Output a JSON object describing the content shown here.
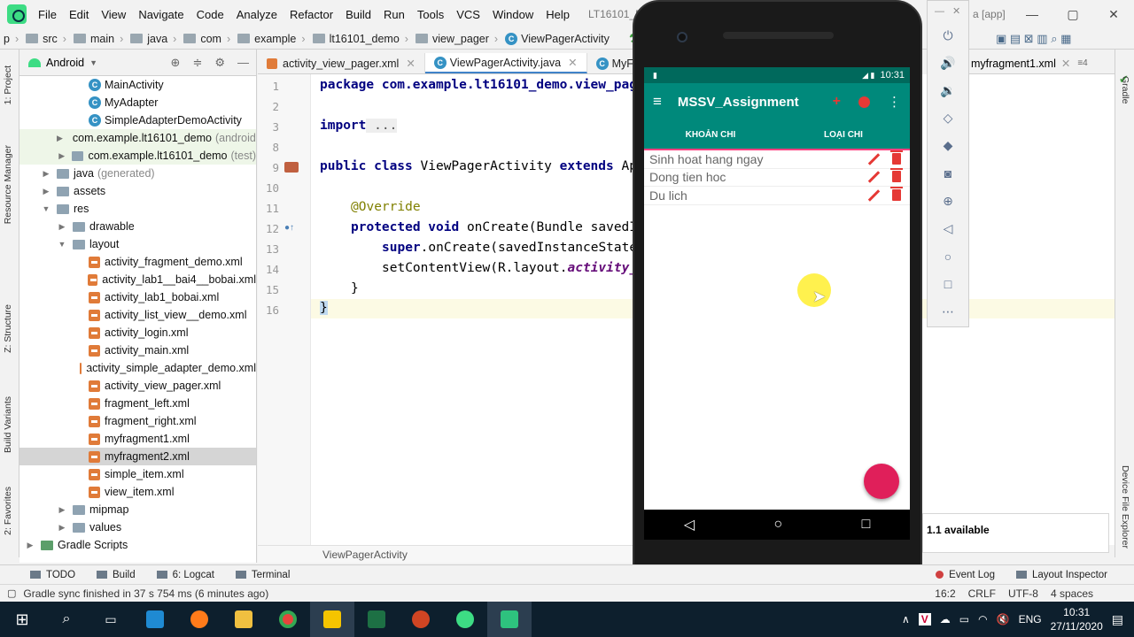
{
  "menubar": {
    "items": [
      "File",
      "Edit",
      "View",
      "Navigate",
      "Code",
      "Analyze",
      "Refactor",
      "Build",
      "Run",
      "Tools",
      "VCS",
      "Window",
      "Help"
    ],
    "window_title": "LT16101_Demo [...\\Dem",
    "window_title_right": "a [app]"
  },
  "breadcrumb": {
    "items": [
      "p",
      "src",
      "main",
      "java",
      "com",
      "example",
      "lt16101_demo",
      "view_pager",
      "ViewPagerActivity"
    ],
    "run_config": "app"
  },
  "left_strip": [
    "1: Project",
    "Resource Manager",
    "Z: Structure",
    "Build Variants",
    "2: Favorites"
  ],
  "right_strip": [
    "Gradle",
    "Device File Explorer"
  ],
  "project": {
    "view_label": "Android",
    "rows": [
      {
        "label": "MainActivity",
        "hint": "",
        "type": "class",
        "indent": 3,
        "arrow": ""
      },
      {
        "label": "MyAdapter",
        "hint": "",
        "type": "class",
        "indent": 3,
        "arrow": ""
      },
      {
        "label": "SimpleAdapterDemoActivity",
        "hint": "",
        "type": "class",
        "indent": 3,
        "arrow": ""
      },
      {
        "label": "com.example.lt16101_demo",
        "hint": "(androidTest)",
        "type": "folder",
        "indent": 2,
        "arrow": "▶"
      },
      {
        "label": "com.example.lt16101_demo",
        "hint": "(test)",
        "type": "folder",
        "indent": 2,
        "arrow": "▶"
      },
      {
        "label": "java",
        "hint": "(generated)",
        "type": "folder",
        "indent": 1,
        "arrow": "▶"
      },
      {
        "label": "assets",
        "hint": "",
        "type": "folder",
        "indent": 1,
        "arrow": "▶"
      },
      {
        "label": "res",
        "hint": "",
        "type": "folder",
        "indent": 1,
        "arrow": "▼"
      },
      {
        "label": "drawable",
        "hint": "",
        "type": "folder",
        "indent": 2,
        "arrow": "▶"
      },
      {
        "label": "layout",
        "hint": "",
        "type": "folder",
        "indent": 2,
        "arrow": "▼"
      },
      {
        "label": "activity_fragment_demo.xml",
        "hint": "",
        "type": "xml",
        "indent": 3,
        "arrow": ""
      },
      {
        "label": "activity_lab1__bai4__bobai.xml",
        "hint": "",
        "type": "xml",
        "indent": 3,
        "arrow": ""
      },
      {
        "label": "activity_lab1_bobai.xml",
        "hint": "",
        "type": "xml",
        "indent": 3,
        "arrow": ""
      },
      {
        "label": "activity_list_view__demo.xml",
        "hint": "",
        "type": "xml",
        "indent": 3,
        "arrow": ""
      },
      {
        "label": "activity_login.xml",
        "hint": "",
        "type": "xml",
        "indent": 3,
        "arrow": ""
      },
      {
        "label": "activity_main.xml",
        "hint": "",
        "type": "xml",
        "indent": 3,
        "arrow": ""
      },
      {
        "label": "activity_simple_adapter_demo.xml",
        "hint": "",
        "type": "xml",
        "indent": 3,
        "arrow": ""
      },
      {
        "label": "activity_view_pager.xml",
        "hint": "",
        "type": "xml",
        "indent": 3,
        "arrow": ""
      },
      {
        "label": "fragment_left.xml",
        "hint": "",
        "type": "xml",
        "indent": 3,
        "arrow": ""
      },
      {
        "label": "fragment_right.xml",
        "hint": "",
        "type": "xml",
        "indent": 3,
        "arrow": ""
      },
      {
        "label": "myfragment1.xml",
        "hint": "",
        "type": "xml",
        "indent": 3,
        "arrow": ""
      },
      {
        "label": "myfragment2.xml",
        "hint": "",
        "type": "xml",
        "indent": 3,
        "arrow": "",
        "selected": true
      },
      {
        "label": "simple_item.xml",
        "hint": "",
        "type": "xml",
        "indent": 3,
        "arrow": ""
      },
      {
        "label": "view_item.xml",
        "hint": "",
        "type": "xml",
        "indent": 3,
        "arrow": ""
      },
      {
        "label": "mipmap",
        "hint": "",
        "type": "folder",
        "indent": 2,
        "arrow": "▶"
      },
      {
        "label": "values",
        "hint": "",
        "type": "folder",
        "indent": 2,
        "arrow": "▶"
      },
      {
        "label": "Gradle Scripts",
        "hint": "",
        "type": "gradle",
        "indent": 0,
        "arrow": "▶"
      }
    ]
  },
  "editor": {
    "tabs": [
      {
        "label": "activity_view_pager.xml",
        "active": false
      },
      {
        "label": "ViewPagerActivity.java",
        "active": true
      },
      {
        "label": "MyFragme",
        "active": false
      }
    ],
    "right_tab": "myfragment1.xml",
    "line_numbers": [
      "1",
      "2",
      "3",
      "8",
      "9",
      "10",
      "11",
      "12",
      "13",
      "14",
      "15",
      "16"
    ],
    "code": {
      "l1": "package com.example.lt16101_demo.view_pag",
      "l3_kw": "import",
      "l3_rest": " ...",
      "l9_kw": "public class ",
      "l9_name": "ViewPagerActivity ",
      "l9_kw2": "extends ",
      "l9_rest": "Ap",
      "l11": "@Override",
      "l12_kw": "protected void ",
      "l12_rest": "onCreate(Bundle savedI",
      "l13_kw": "super",
      "l13_rest": ".onCreate(savedInstanceState",
      "l14_a": "setContentView(R.layout.",
      "l14_b": "activity_",
      "l15": "}",
      "l16": "}"
    },
    "footer": "ViewPagerActivity"
  },
  "emulator": {
    "status_time": "10:31",
    "app_title": "MSSV_Assignment",
    "tabs": [
      "KHOẢN CHI",
      "LOẠI CHI"
    ],
    "items": [
      "Sinh hoat hang ngay",
      "Dong tien hoc",
      "Du lich"
    ],
    "colors": {
      "primary": "#00897b",
      "accent": "#ff4081",
      "fab": "#e01f5a",
      "action_icons": "#e53935"
    }
  },
  "notification": "1.1 available",
  "toolwindows": {
    "left": [
      "TODO",
      "Build",
      "6: Logcat",
      "Terminal"
    ],
    "right": [
      "Event Log",
      "Layout Inspector"
    ]
  },
  "status": {
    "message": "Gradle sync finished in 37 s 754 ms (6 minutes ago)",
    "position": "16:2",
    "line_sep": "CRLF",
    "encoding": "UTF-8",
    "indent": "4 spaces"
  },
  "taskbar": {
    "lang": "ENG",
    "time": "10:31",
    "date": "27/11/2020"
  }
}
